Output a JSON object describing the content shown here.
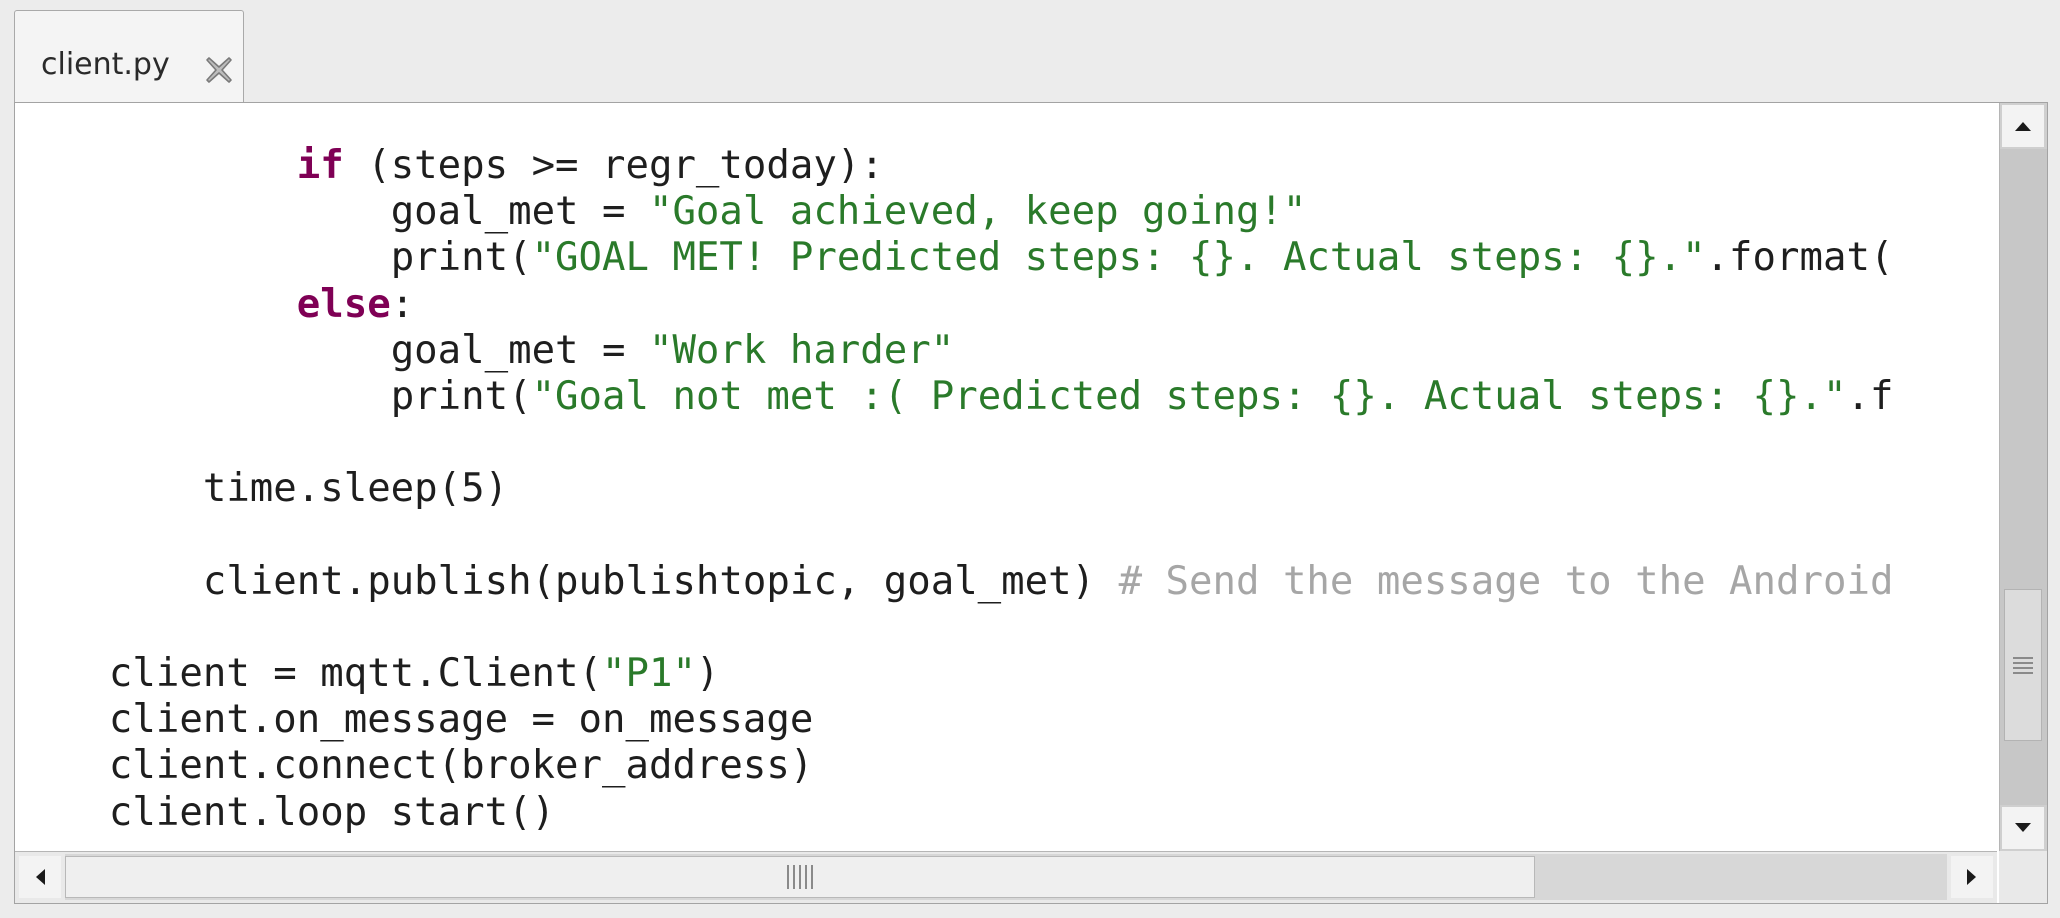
{
  "tab": {
    "title": "client.py",
    "close_icon": "close-x-icon"
  },
  "editor": {
    "lines": [
      {
        "indent": "            ",
        "parts": [
          {
            "t": "kw",
            "s": "if"
          },
          {
            "t": "n",
            "s": " (steps >= regr_today):"
          }
        ]
      },
      {
        "indent": "                ",
        "parts": [
          {
            "t": "n",
            "s": "goal_met = "
          },
          {
            "t": "str",
            "s": "\"Goal achieved, keep going!\""
          }
        ]
      },
      {
        "indent": "                ",
        "parts": [
          {
            "t": "n",
            "s": "print("
          },
          {
            "t": "str",
            "s": "\"GOAL MET! Predicted steps: {}. Actual steps: {}.\""
          },
          {
            "t": "n",
            "s": ".format("
          }
        ]
      },
      {
        "indent": "            ",
        "parts": [
          {
            "t": "kw",
            "s": "else"
          },
          {
            "t": "n",
            "s": ":"
          }
        ]
      },
      {
        "indent": "                ",
        "parts": [
          {
            "t": "n",
            "s": "goal_met = "
          },
          {
            "t": "str",
            "s": "\"Work harder\""
          }
        ]
      },
      {
        "indent": "                ",
        "parts": [
          {
            "t": "n",
            "s": "print("
          },
          {
            "t": "str",
            "s": "\"Goal not met :( Predicted steps: {}. Actual steps: {}.\""
          },
          {
            "t": "n",
            "s": ".f"
          }
        ]
      },
      {
        "indent": "",
        "parts": []
      },
      {
        "indent": "        ",
        "parts": [
          {
            "t": "n",
            "s": "time.sleep(5)"
          }
        ]
      },
      {
        "indent": "",
        "parts": []
      },
      {
        "indent": "        ",
        "parts": [
          {
            "t": "n",
            "s": "client.publish(publishtopic, goal_met) "
          },
          {
            "t": "cmt",
            "s": "# Send the message to the Android"
          }
        ]
      },
      {
        "indent": "",
        "parts": []
      },
      {
        "indent": "    ",
        "parts": [
          {
            "t": "n",
            "s": "client = mqtt.Client("
          },
          {
            "t": "str",
            "s": "\"P1\""
          },
          {
            "t": "n",
            "s": ")"
          }
        ]
      },
      {
        "indent": "    ",
        "parts": [
          {
            "t": "n",
            "s": "client.on_message = on_message"
          }
        ]
      },
      {
        "indent": "    ",
        "parts": [
          {
            "t": "n",
            "s": "client.connect(broker_address)"
          }
        ]
      },
      {
        "indent": "    ",
        "parts": [
          {
            "t": "n",
            "s": "client.loop start()"
          }
        ]
      }
    ]
  },
  "scrollbars": {
    "vertical_up_icon": "arrow-up-icon",
    "vertical_down_icon": "arrow-down-icon",
    "horizontal_left_icon": "arrow-left-icon",
    "horizontal_right_icon": "arrow-right-icon",
    "grip_icon": "grip-lines-icon"
  },
  "colors": {
    "keyword": "#7f0055",
    "string": "#2a7a2a",
    "comment": "#a6a6a6",
    "text": "#1e1e1e"
  }
}
